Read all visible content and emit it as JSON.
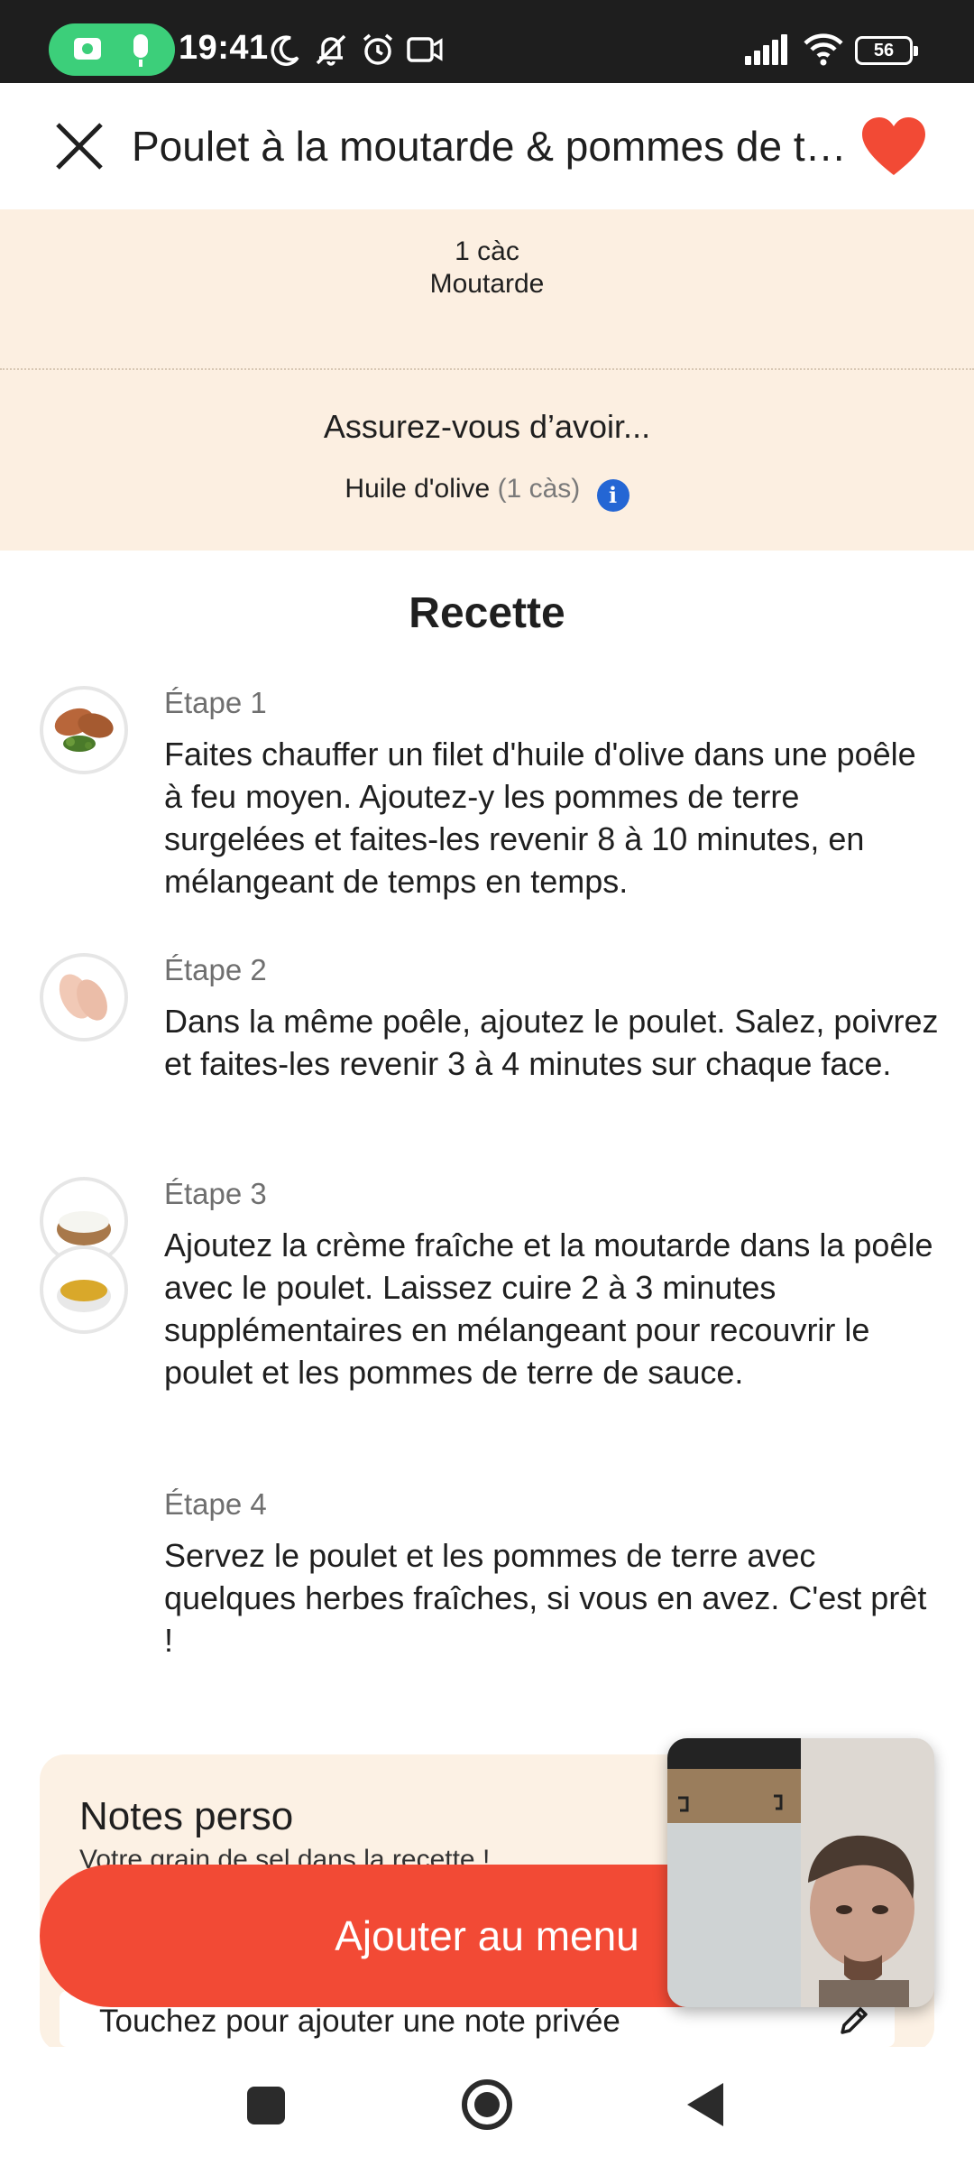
{
  "status_bar": {
    "time": "19:41",
    "battery": "56",
    "icons": [
      "camera-icon",
      "microphone-icon",
      "moon-icon",
      "bell-off-icon",
      "alarm-icon",
      "screen-record-icon",
      "signal-icon",
      "wifi-icon",
      "battery-icon"
    ]
  },
  "header": {
    "title": "Poulet à la moutarde & pommes de terre",
    "favorite": true,
    "favorite_color": "#f24a35"
  },
  "ingredients": {
    "item": {
      "quantity": "1 càc",
      "name": "Moutarde"
    },
    "ensure_title": "Assurez-vous d’avoir...",
    "pantry_item": {
      "name": "Huile d'olive",
      "quantity": "(1 càs)"
    }
  },
  "recipe": {
    "title": "Recette",
    "steps": [
      {
        "label": "Étape 1",
        "text": "Faites chauffer un filet d'huile d'olive dans une poêle à feu moyen. Ajoutez-y les pommes de terre surgelées et faites-les revenir 8 à 10 minutes, en mélangeant de temps en temps."
      },
      {
        "label": "Étape 2",
        "text": "Dans la même poêle, ajoutez le poulet. Salez, poivrez et faites-les revenir 3 à 4 minutes sur chaque face."
      },
      {
        "label": "Étape 3",
        "text": "Ajoutez la crème fraîche et la moutarde dans la poêle avec le poulet. Laissez cuire 2 à 3 minutes supplémentaires en mélangeant pour recouvrir le poulet et les pommes de terre de sauce."
      },
      {
        "label": "Étape 4",
        "text": "Servez le poulet et les pommes de terre avec quelques herbes fraîches, si vous en avez. C'est prêt !"
      }
    ]
  },
  "notes": {
    "title": "Notes perso",
    "subtitle": "Votre grain de sel dans la recette !",
    "input_placeholder": "Touchez pour ajouter une note privée"
  },
  "cta": {
    "label": "Ajouter au menu",
    "color": "#f24a35"
  },
  "colors": {
    "beige": "#fcefe1",
    "notes_bg": "#fcf1e4",
    "info": "#2466d4"
  }
}
